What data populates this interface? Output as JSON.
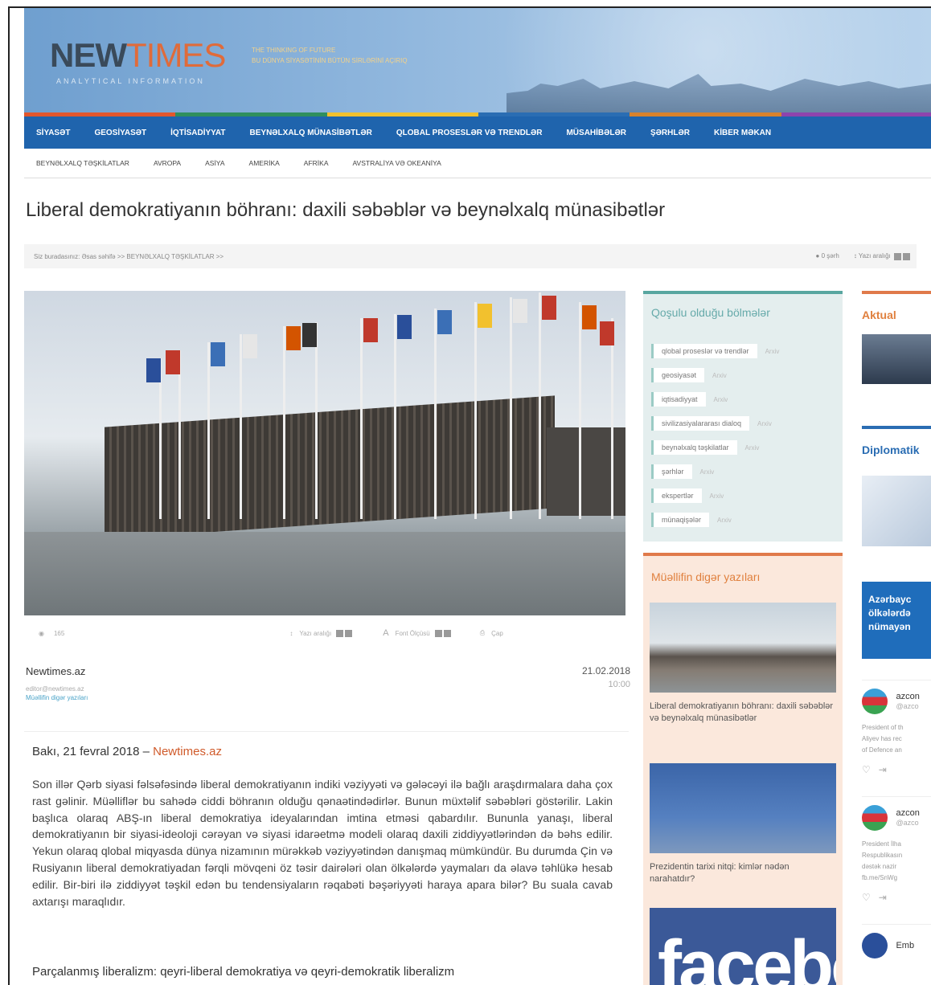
{
  "header": {
    "logo_part1": "NEW",
    "logo_part2": "TIMES",
    "logo_sub": "ANALYTICAL INFORMATION",
    "tagline_line1": "THE THINKING OF FUTURE",
    "tagline_line2": "BU DÜNYA SİYASƏTİNİN BÜTÜN SİRLƏRİNİ AÇIRIQ"
  },
  "colorbar": [
    "#e2572d",
    "#2f8f5e",
    "#f2c12e",
    "#2a6db3",
    "#d9822b",
    "#8e44ad"
  ],
  "nav": [
    "SİYASƏT",
    "GEOSİYASƏT",
    "İQTİSADİYYAT",
    "BEYNƏLXALQ MÜNASİBƏTLƏR",
    "QLOBAL PROSESLƏR VƏ TRENDLƏR",
    "MÜSAHİBƏLƏR",
    "ŞƏRHLƏR",
    "KİBER MƏKAN"
  ],
  "subnav": [
    "BEYNƏLXALQ TƏŞKİLATLAR",
    "AVROPA",
    "ASİYA",
    "AMERİKA",
    "AFRİKA",
    "AVSTRALİYA VƏ OKEANİYA"
  ],
  "article": {
    "title": "Liberal demokratiyanın böhranı: daxili səbəblər və beynəlxalq münasibətlər",
    "breadcrumb": "Siz buradasınız: Əsas səhifə >> BEYNƏLXALQ TƏŞKİLATLAR >>",
    "comment_label": "0 şərh",
    "font_size_label": "Yazı aralığı",
    "views": "165",
    "line_spacing_label": "Yazı aralığı",
    "font_label": "Font Ölçüsü",
    "print_label": "Çap",
    "source": "Newtimes.az",
    "email": "editor@newtimes.az",
    "author_more": "Müəllifin digər yazıları",
    "date": "21.02.2018",
    "time": "10:00",
    "dateline_prefix": "Bakı, 21 fevral 2018 – ",
    "dateline_source": "Newtimes.az",
    "paragraph": "Son illər Qərb siyasi fəlsəfəsində liberal demokratiyanın indiki vəziyyəti və gələcəyi ilə bağlı araşdırmalara daha çox rast gəlinir. Müəlliflər bu sahədə ciddi böhranın olduğu qənaətindədirlər. Bunun müxtəlif səbəbləri göstərilir. Lakin başlıca olaraq ABŞ-ın liberal demokratiya ideyalarından imtina etməsi qabardılır. Bununla yanaşı, liberal demokratiyanın bir siyasi-ideoloji cərəyan və siyasi idarəetmə modeli olaraq daxili ziddiyyətlərindən də bəhs edilir. Yekun olaraq qlobal miqyasda dünya nizamının mürəkkəb vəziyyətindən danışmaq mümkündür. Bu durumda Çin və Rusiyanın liberal demokratiyadan fərqli mövqeni öz təsir dairələri olan ölkələrdə yaymaları da əlavə təhlükə hesab edilir. Bir-biri ilə ziddiyyət təşkil edən bu tendensiyaların rəqabəti bəşəriyyəti haraya apara bilər? Bu suala cavab axtarışı maraqlıdır.",
    "subheading": "Parçalanmış liberalizm: qeyri-liberal demokratiya və qeyri-demokratik liberalizm"
  },
  "sections_panel": {
    "title": "Qoşulu olduğu bölmələr",
    "archive_label": "Arxiv",
    "tags": [
      "qlobal proseslər və trendlər",
      "geosiyasət",
      "iqtisadiyyat",
      "sivilizasiyalararası dialoq",
      "beynəlxalq təşkilatlar",
      "şərhlər",
      "ekspertlər",
      "münaqişələr"
    ]
  },
  "author_panel": {
    "title": "Müəllifin digər yazıları",
    "items": [
      {
        "caption": "Liberal demokratiyanın böhranı: daxili səbəblər və beynəlxalq münasibətlər"
      },
      {
        "caption": "Prezidentin tarixi nitqi: kimlər nədən narahatdır?"
      }
    ],
    "fb_text": "facebook"
  },
  "right_col": {
    "aktual": "Aktual",
    "diplomatik": "Diplomatik",
    "banner_line1": "Azərbayc",
    "banner_line2": "ölkələrdə",
    "banner_line3": "nümayən",
    "tweet1_name": "azcon",
    "tweet1_handle": "@azco",
    "tweet1_text1": "President of th",
    "tweet1_text2": "Aliyev has rec",
    "tweet1_text3": "of Defence an",
    "tweet2_name": "azcon",
    "tweet2_handle": "@azco",
    "tweet2_text1": "President İlha",
    "tweet2_text2": "Respublikasın",
    "tweet2_text3": "dəstək nazir",
    "tweet2_text4": "fb.me/SnWg",
    "tweet3_name": "Emb"
  }
}
